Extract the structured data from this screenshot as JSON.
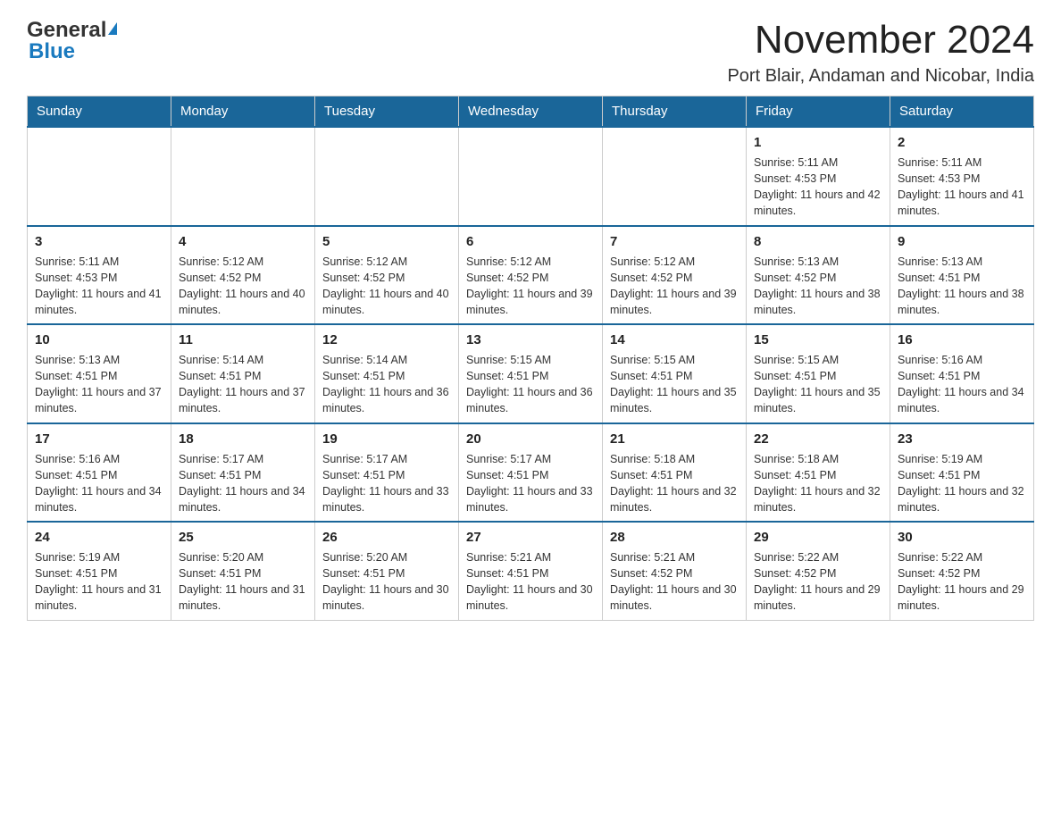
{
  "header": {
    "logo_general": "General",
    "logo_blue": "Blue",
    "title": "November 2024",
    "subtitle": "Port Blair, Andaman and Nicobar, India"
  },
  "calendar": {
    "days_of_week": [
      "Sunday",
      "Monday",
      "Tuesday",
      "Wednesday",
      "Thursday",
      "Friday",
      "Saturday"
    ],
    "weeks": [
      [
        {
          "day": "",
          "info": ""
        },
        {
          "day": "",
          "info": ""
        },
        {
          "day": "",
          "info": ""
        },
        {
          "day": "",
          "info": ""
        },
        {
          "day": "",
          "info": ""
        },
        {
          "day": "1",
          "info": "Sunrise: 5:11 AM\nSunset: 4:53 PM\nDaylight: 11 hours and 42 minutes."
        },
        {
          "day": "2",
          "info": "Sunrise: 5:11 AM\nSunset: 4:53 PM\nDaylight: 11 hours and 41 minutes."
        }
      ],
      [
        {
          "day": "3",
          "info": "Sunrise: 5:11 AM\nSunset: 4:53 PM\nDaylight: 11 hours and 41 minutes."
        },
        {
          "day": "4",
          "info": "Sunrise: 5:12 AM\nSunset: 4:52 PM\nDaylight: 11 hours and 40 minutes."
        },
        {
          "day": "5",
          "info": "Sunrise: 5:12 AM\nSunset: 4:52 PM\nDaylight: 11 hours and 40 minutes."
        },
        {
          "day": "6",
          "info": "Sunrise: 5:12 AM\nSunset: 4:52 PM\nDaylight: 11 hours and 39 minutes."
        },
        {
          "day": "7",
          "info": "Sunrise: 5:12 AM\nSunset: 4:52 PM\nDaylight: 11 hours and 39 minutes."
        },
        {
          "day": "8",
          "info": "Sunrise: 5:13 AM\nSunset: 4:52 PM\nDaylight: 11 hours and 38 minutes."
        },
        {
          "day": "9",
          "info": "Sunrise: 5:13 AM\nSunset: 4:51 PM\nDaylight: 11 hours and 38 minutes."
        }
      ],
      [
        {
          "day": "10",
          "info": "Sunrise: 5:13 AM\nSunset: 4:51 PM\nDaylight: 11 hours and 37 minutes."
        },
        {
          "day": "11",
          "info": "Sunrise: 5:14 AM\nSunset: 4:51 PM\nDaylight: 11 hours and 37 minutes."
        },
        {
          "day": "12",
          "info": "Sunrise: 5:14 AM\nSunset: 4:51 PM\nDaylight: 11 hours and 36 minutes."
        },
        {
          "day": "13",
          "info": "Sunrise: 5:15 AM\nSunset: 4:51 PM\nDaylight: 11 hours and 36 minutes."
        },
        {
          "day": "14",
          "info": "Sunrise: 5:15 AM\nSunset: 4:51 PM\nDaylight: 11 hours and 35 minutes."
        },
        {
          "day": "15",
          "info": "Sunrise: 5:15 AM\nSunset: 4:51 PM\nDaylight: 11 hours and 35 minutes."
        },
        {
          "day": "16",
          "info": "Sunrise: 5:16 AM\nSunset: 4:51 PM\nDaylight: 11 hours and 34 minutes."
        }
      ],
      [
        {
          "day": "17",
          "info": "Sunrise: 5:16 AM\nSunset: 4:51 PM\nDaylight: 11 hours and 34 minutes."
        },
        {
          "day": "18",
          "info": "Sunrise: 5:17 AM\nSunset: 4:51 PM\nDaylight: 11 hours and 34 minutes."
        },
        {
          "day": "19",
          "info": "Sunrise: 5:17 AM\nSunset: 4:51 PM\nDaylight: 11 hours and 33 minutes."
        },
        {
          "day": "20",
          "info": "Sunrise: 5:17 AM\nSunset: 4:51 PM\nDaylight: 11 hours and 33 minutes."
        },
        {
          "day": "21",
          "info": "Sunrise: 5:18 AM\nSunset: 4:51 PM\nDaylight: 11 hours and 32 minutes."
        },
        {
          "day": "22",
          "info": "Sunrise: 5:18 AM\nSunset: 4:51 PM\nDaylight: 11 hours and 32 minutes."
        },
        {
          "day": "23",
          "info": "Sunrise: 5:19 AM\nSunset: 4:51 PM\nDaylight: 11 hours and 32 minutes."
        }
      ],
      [
        {
          "day": "24",
          "info": "Sunrise: 5:19 AM\nSunset: 4:51 PM\nDaylight: 11 hours and 31 minutes."
        },
        {
          "day": "25",
          "info": "Sunrise: 5:20 AM\nSunset: 4:51 PM\nDaylight: 11 hours and 31 minutes."
        },
        {
          "day": "26",
          "info": "Sunrise: 5:20 AM\nSunset: 4:51 PM\nDaylight: 11 hours and 30 minutes."
        },
        {
          "day": "27",
          "info": "Sunrise: 5:21 AM\nSunset: 4:51 PM\nDaylight: 11 hours and 30 minutes."
        },
        {
          "day": "28",
          "info": "Sunrise: 5:21 AM\nSunset: 4:52 PM\nDaylight: 11 hours and 30 minutes."
        },
        {
          "day": "29",
          "info": "Sunrise: 5:22 AM\nSunset: 4:52 PM\nDaylight: 11 hours and 29 minutes."
        },
        {
          "day": "30",
          "info": "Sunrise: 5:22 AM\nSunset: 4:52 PM\nDaylight: 11 hours and 29 minutes."
        }
      ]
    ]
  }
}
